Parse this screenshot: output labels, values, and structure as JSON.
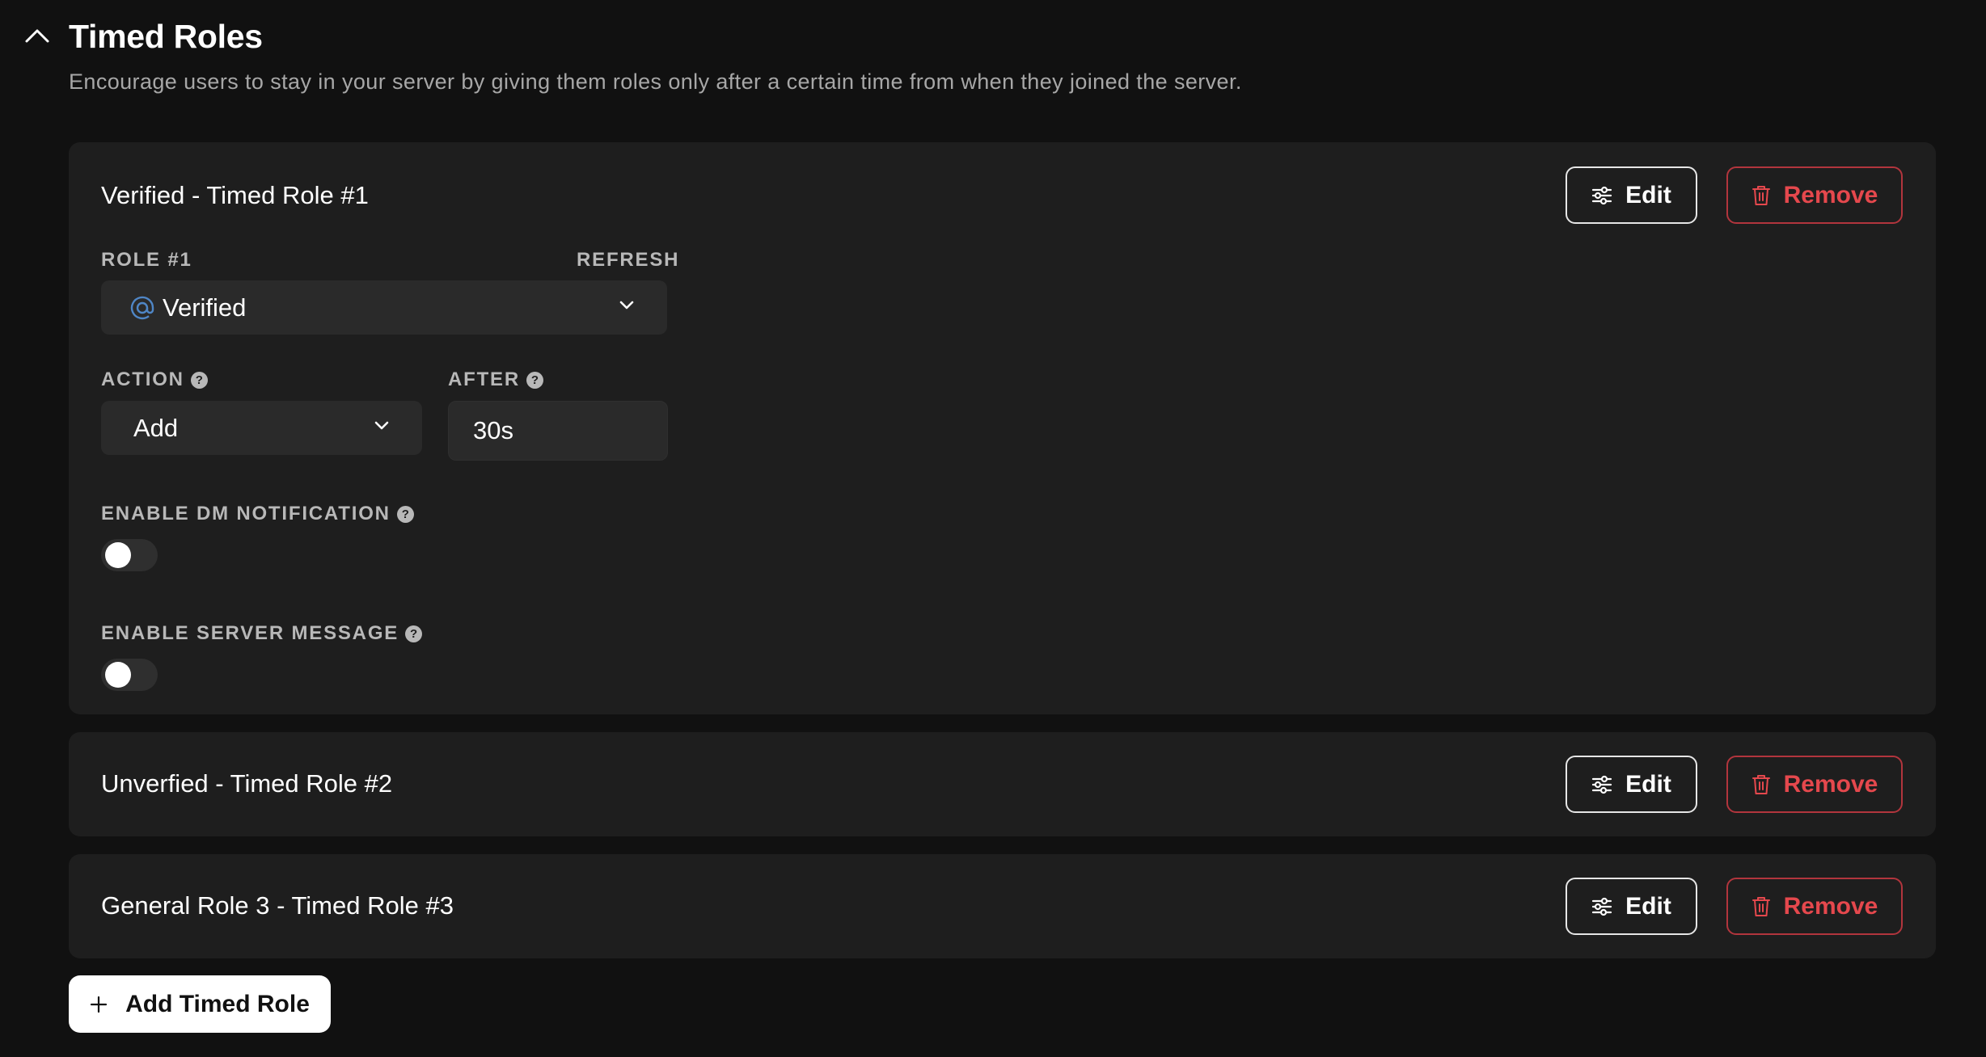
{
  "section": {
    "title": "Timed Roles",
    "description": "Encourage users to stay in your server by giving them roles only after a certain time from when they joined the server."
  },
  "timed_roles": [
    {
      "title": "Verified - Timed Role #1",
      "expanded": true,
      "role_label": "ROLE #1",
      "refresh_label": "REFRESH",
      "role_value": "Verified",
      "action_label": "ACTION",
      "action_value": "Add",
      "after_label": "AFTER",
      "after_value": "30s",
      "dm_notification_label": "ENABLE DM NOTIFICATION",
      "dm_notification_enabled": false,
      "server_message_label": "ENABLE SERVER MESSAGE",
      "server_message_enabled": false
    },
    {
      "title": "Unverfied - Timed Role #2",
      "expanded": false
    },
    {
      "title": "General Role 3 - Timed Role #3",
      "expanded": false
    }
  ],
  "buttons": {
    "edit_label": "Edit",
    "remove_label": "Remove",
    "add_label": "Add Timed Role",
    "help_glyph": "?"
  },
  "icons": {
    "collapse": "chevron-up-icon",
    "edit": "sliders-icon",
    "remove": "trash-icon",
    "role": "at-sign-icon",
    "add": "plus-icon"
  },
  "colors": {
    "background": "#111111",
    "card": "#1e1e1e",
    "input": "#2a2a2a",
    "danger": "#e5484d",
    "role_icon": "#4f86c6"
  }
}
